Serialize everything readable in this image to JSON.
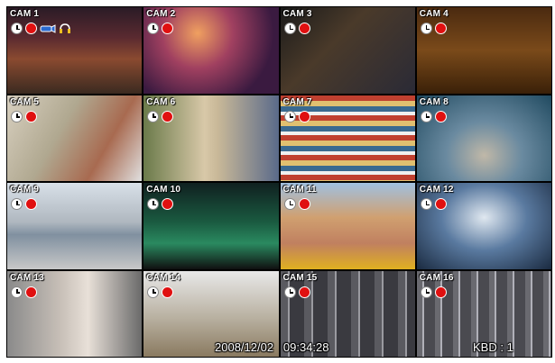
{
  "cameras": [
    {
      "label": "CAM 1"
    },
    {
      "label": "CAM 2"
    },
    {
      "label": "CAM 3"
    },
    {
      "label": "CAM 4"
    },
    {
      "label": "CAM 5"
    },
    {
      "label": "CAM 6"
    },
    {
      "label": "CAM 7"
    },
    {
      "label": "CAM 8"
    },
    {
      "label": "CAM 9"
    },
    {
      "label": "CAM 10"
    },
    {
      "label": "CAM 11"
    },
    {
      "label": "CAM 12"
    },
    {
      "label": "CAM 13"
    },
    {
      "label": "CAM 14"
    },
    {
      "label": "CAM 15"
    },
    {
      "label": "CAM 16"
    }
  ],
  "status_icons": {
    "schedule": "clock-icon",
    "recording": "record-indicator-icon",
    "cam1_extra": [
      "camera-motion-icon",
      "audio-icon"
    ]
  },
  "overlay": {
    "datetime": "2008/12/02   09:34:28",
    "keyboard": "KBD : 1"
  },
  "colors": {
    "recording": "#e01010",
    "label_text": "#ffffff",
    "grid_border": "#000000"
  }
}
